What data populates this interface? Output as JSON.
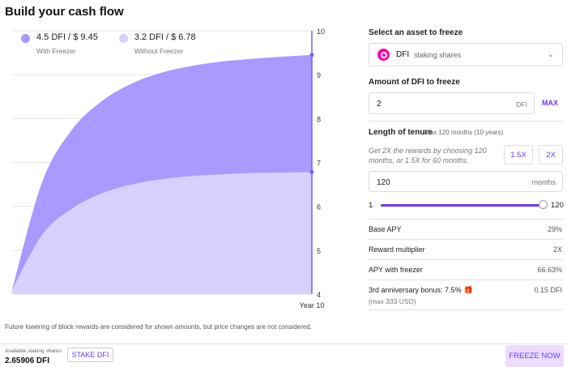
{
  "title": "Build your cash flow",
  "chart_data": {
    "type": "area",
    "x": [
      0,
      1,
      2,
      3,
      4,
      5,
      6,
      7,
      8,
      9,
      10
    ],
    "xlabel": "Year 10",
    "ylim": [
      4,
      10
    ],
    "yticks": [
      4,
      5,
      6,
      7,
      8,
      9,
      10
    ],
    "grid": true,
    "legend_position": "top-left",
    "series": [
      {
        "name": "4.5 DFI / $ 9.45",
        "sub": "With Freezer",
        "color": "#aa99ff",
        "values": [
          4.1,
          6.55,
          7.75,
          8.4,
          8.8,
          9.05,
          9.2,
          9.3,
          9.36,
          9.41,
          9.45
        ]
      },
      {
        "name": "3.2 DFI / $ 6.78",
        "sub": "Without Freezer",
        "color": "#d9d0ff",
        "values": [
          4.1,
          5.35,
          5.95,
          6.3,
          6.5,
          6.62,
          6.69,
          6.73,
          6.76,
          6.77,
          6.78
        ]
      }
    ]
  },
  "footnote": "Future lowering of block rewards are considered for shown amounts, but price changes are not considered.",
  "asset": {
    "label": "Select an asset to freeze",
    "name": "DFI",
    "desc": "staking shares",
    "chevron": "chevron-down-icon"
  },
  "amount": {
    "label": "Amount of DFI to freeze",
    "value": "2",
    "unit": "DFI",
    "max": "MAX"
  },
  "tenure": {
    "label": "Length of tenure",
    "hint": "Max 120 months (10 years)",
    "promo": "Get 2X the rewards by choosing 120 months, or 1.5X for 60 months.",
    "btn_15": "1.5X",
    "btn_2": "2X",
    "value": "120",
    "unit": "months",
    "slider_min": "1",
    "slider_max": "120",
    "slider_fraction": 1.0
  },
  "rows": {
    "base_apy_label": "Base APY",
    "base_apy_value": "29%",
    "multiplier_label": "Reward multiplier",
    "multiplier_value": "2X",
    "apy_freezer_label": "APY with freezer",
    "apy_freezer_value": "66.63%",
    "bonus_label": "3rd anniversary bonus: 7.5%",
    "bonus_value": "0.15 DFI",
    "bonus_sub": "(max 333 USD)",
    "gift_icon": "gift-icon"
  },
  "footer": {
    "avail_label": "Available staking shares",
    "avail_value": "2.65906 DFI",
    "stake_btn": "STAKE DFI",
    "freeze_btn": "FREEZE NOW"
  },
  "colors": {
    "accent": "#6b3cff",
    "freeze_bg": "#ecdcff",
    "asset_logo": "#ff00af"
  }
}
